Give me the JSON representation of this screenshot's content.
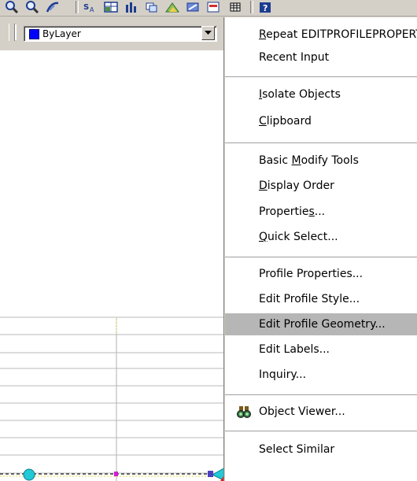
{
  "toolbar": {
    "icons": [
      "zoom-icon",
      "zoom-window-icon",
      "pan-icon",
      "text-style-icon",
      "table-icon",
      "chart-icon",
      "layer-icon",
      "survey-icon",
      "edit-icon",
      "check-icon",
      "grid-icon",
      "help-icon"
    ]
  },
  "property_bar": {
    "color_label": "ByLayer",
    "color_swatch": "#0000ff"
  },
  "context_menu": {
    "items": [
      {
        "label": "Repeat EDITPROFILEPROPERTIES",
        "mnemonic": "R"
      },
      {
        "label": "Recent Input"
      },
      {
        "label": "Isolate Objects",
        "mnemonic": "I"
      },
      {
        "label": "Clipboard",
        "mnemonic": "C"
      },
      {
        "label": "Basic Modify Tools",
        "mnemonic": "M"
      },
      {
        "label": "Display Order",
        "mnemonic": "D"
      },
      {
        "label": "Properties...",
        "mnemonic": "s"
      },
      {
        "label": "Quick Select...",
        "mnemonic": "Q"
      },
      {
        "label": "Profile Properties..."
      },
      {
        "label": "Edit Profile Style..."
      },
      {
        "label": "Edit Profile Geometry...",
        "highlighted": true
      },
      {
        "label": "Edit Labels..."
      },
      {
        "label": "Inquiry..."
      },
      {
        "label": "Object Viewer...",
        "icon": "binoculars-icon"
      },
      {
        "label": "Select Similar"
      }
    ]
  }
}
